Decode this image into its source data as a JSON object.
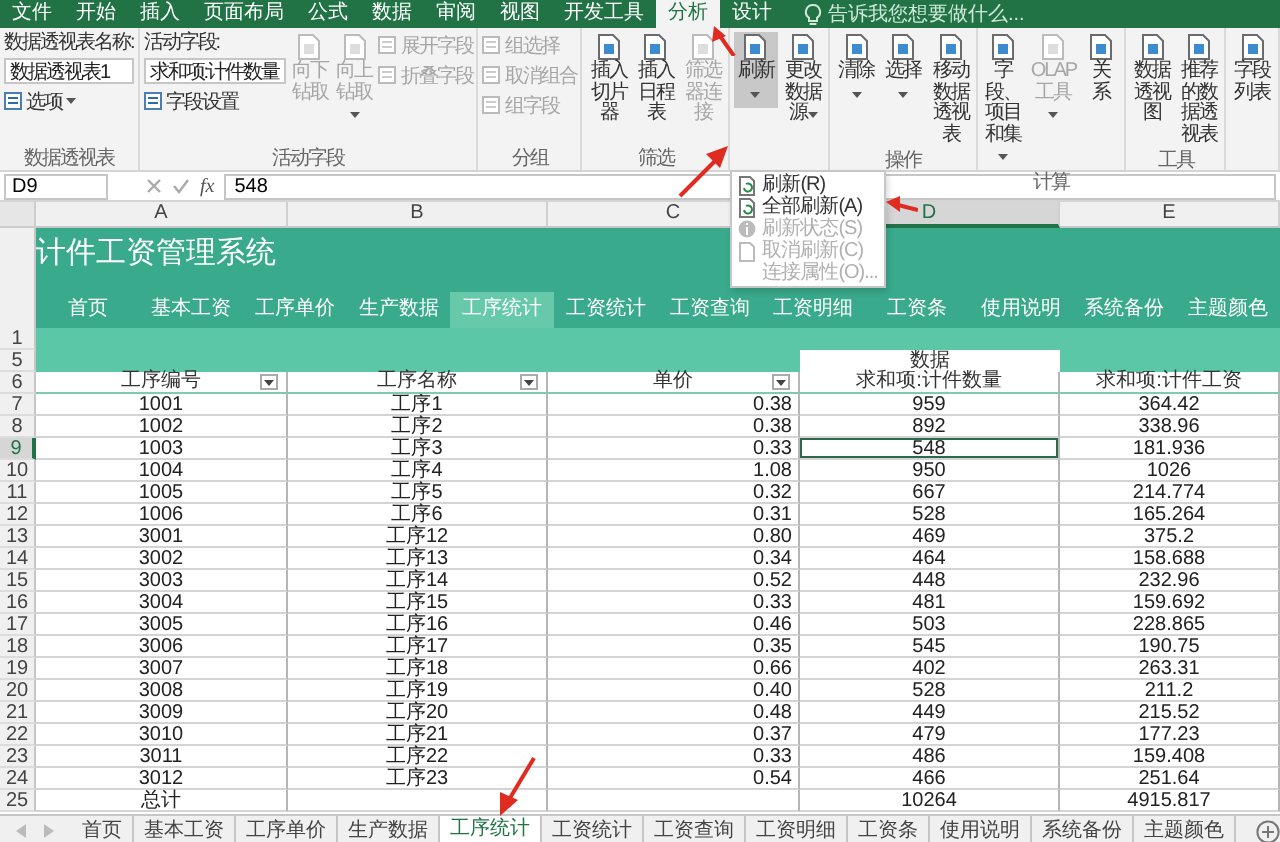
{
  "ribbon_tabs": [
    {
      "label": "文件",
      "selected": false
    },
    {
      "label": "开始",
      "selected": false
    },
    {
      "label": "插入",
      "selected": false
    },
    {
      "label": "页面布局",
      "selected": false
    },
    {
      "label": "公式",
      "selected": false
    },
    {
      "label": "数据",
      "selected": false
    },
    {
      "label": "审阅",
      "selected": false
    },
    {
      "label": "视图",
      "selected": false
    },
    {
      "label": "开发工具",
      "selected": false
    },
    {
      "label": "分析",
      "selected": true,
      "arrow": true
    },
    {
      "label": "设计",
      "selected": false
    }
  ],
  "tell_me": {
    "placeholder": "告诉我您想要做什么..."
  },
  "ribbon_groups": [
    {
      "label": "数据透视表",
      "columns": [
        {
          "kind": "stack",
          "items": [
            {
              "kind": "text",
              "text": "数据透视表名称:"
            },
            {
              "kind": "field",
              "value": "数据透视表1"
            },
            {
              "kind": "small",
              "label": "选项",
              "dropdown": true,
              "disabled": false
            }
          ]
        }
      ]
    },
    {
      "label": "活动字段",
      "columns": [
        {
          "kind": "stack",
          "items": [
            {
              "kind": "text",
              "text": "活动字段:"
            },
            {
              "kind": "field",
              "value": "求和项:计件数量"
            },
            {
              "kind": "small",
              "label": "字段设置",
              "disabled": false
            }
          ]
        },
        {
          "kind": "large",
          "label": "向下钻取",
          "disabled": true
        },
        {
          "kind": "large",
          "label": "向上钻取",
          "dropdown": true,
          "disabled": true
        },
        {
          "kind": "stack",
          "items": [
            {
              "kind": "small",
              "label": "展开字段",
              "disabled": true
            },
            {
              "kind": "small",
              "label": "折叠字段",
              "disabled": true
            }
          ]
        }
      ]
    },
    {
      "label": "分组",
      "columns": [
        {
          "kind": "stack",
          "items": [
            {
              "kind": "small",
              "label": "组选择",
              "disabled": true
            },
            {
              "kind": "small",
              "label": "取消组合",
              "disabled": true
            },
            {
              "kind": "small",
              "label": "组字段",
              "disabled": true
            }
          ]
        }
      ]
    },
    {
      "label": "筛选",
      "columns": [
        {
          "kind": "large",
          "label": "插入切片器",
          "disabled": false
        },
        {
          "kind": "large",
          "label": "插入日程表",
          "disabled": false
        },
        {
          "kind": "large",
          "label": "筛选器连接",
          "disabled": true
        }
      ]
    },
    {
      "columns": [
        {
          "kind": "large",
          "label": "刷新",
          "dropdown": true,
          "disabled": false,
          "pressed": true,
          "arrow": true
        },
        {
          "kind": "large",
          "label": "更改数据源",
          "dropdown": true,
          "disabled": false
        }
      ]
    },
    {
      "label": "操作",
      "columns": [
        {
          "kind": "large",
          "label": "清除",
          "dropdown": true,
          "disabled": false
        },
        {
          "kind": "large",
          "label": "选择",
          "dropdown": true,
          "disabled": false
        },
        {
          "kind": "large",
          "label": "移动数据透视表",
          "disabled": false
        }
      ]
    },
    {
      "label": "计算",
      "columns": [
        {
          "kind": "large",
          "label": "字段、项目和集",
          "dropdown": true,
          "disabled": false
        },
        {
          "kind": "large",
          "label": "OLAP 工具",
          "dropdown": true,
          "disabled": true
        },
        {
          "kind": "large",
          "label": "关系",
          "disabled": false
        }
      ]
    },
    {
      "label": "工具",
      "columns": [
        {
          "kind": "large",
          "label": "数据透视图",
          "disabled": false
        },
        {
          "kind": "large",
          "label": "推荐的数据透视表",
          "disabled": false
        }
      ]
    },
    {
      "columns": [
        {
          "kind": "large",
          "label": "字段列表",
          "disabled": false
        }
      ]
    }
  ],
  "refresh_menu": [
    {
      "label": "刷新(R)",
      "disabled": false
    },
    {
      "label": "全部刷新(A)",
      "disabled": false,
      "arrow": true
    },
    {
      "label": "刷新状态(S)",
      "disabled": true
    },
    {
      "label": "取消刷新(C)",
      "disabled": true
    },
    {
      "label": "连接属性(O)...",
      "disabled": true
    }
  ],
  "formula_bar": {
    "name_box": "D9",
    "fx": "fx",
    "value": "548"
  },
  "columns": [
    {
      "label": "A",
      "selected": false
    },
    {
      "label": "B",
      "selected": false
    },
    {
      "label": "C",
      "selected": false
    },
    {
      "label": "D",
      "selected": true
    },
    {
      "label": "E",
      "selected": false
    }
  ],
  "banner": {
    "title": "计件工资管理系统",
    "nav": [
      {
        "label": "首页",
        "selected": false
      },
      {
        "label": "基本工资",
        "selected": false
      },
      {
        "label": "工序单价",
        "selected": false
      },
      {
        "label": "生产数据",
        "selected": false
      },
      {
        "label": "工序统计",
        "selected": true
      },
      {
        "label": "工资统计",
        "selected": false
      },
      {
        "label": "工资查询",
        "selected": false
      },
      {
        "label": "工资明细",
        "selected": false
      },
      {
        "label": "工资条",
        "selected": false
      },
      {
        "label": "使用说明",
        "selected": false
      },
      {
        "label": "系统备份",
        "selected": false
      },
      {
        "label": "主题颜色",
        "selected": false
      }
    ]
  },
  "band_row": "1",
  "pivot_row": {
    "number": "5",
    "label": "数据"
  },
  "header_row": {
    "number": "6",
    "cells": [
      {
        "text": "工序编号",
        "filter": true
      },
      {
        "text": "工序名称",
        "filter": true
      },
      {
        "text": "单价",
        "filter": true
      },
      {
        "text": "求和项:计件数量",
        "filter": false
      },
      {
        "text": "求和项:计件工资",
        "filter": false
      }
    ]
  },
  "rows": [
    {
      "number": "7",
      "selected": false,
      "cells": [
        "1001",
        "工序1",
        "0.38",
        "959",
        "364.42"
      ]
    },
    {
      "number": "8",
      "selected": false,
      "cells": [
        "1002",
        "工序2",
        "0.38",
        "892",
        "338.96"
      ]
    },
    {
      "number": "9",
      "selected": true,
      "cells": [
        "1003",
        "工序3",
        "0.33",
        "548",
        "181.936"
      ]
    },
    {
      "number": "10",
      "selected": false,
      "cells": [
        "1004",
        "工序4",
        "1.08",
        "950",
        "1026"
      ]
    },
    {
      "number": "11",
      "selected": false,
      "cells": [
        "1005",
        "工序5",
        "0.32",
        "667",
        "214.774"
      ]
    },
    {
      "number": "12",
      "selected": false,
      "cells": [
        "1006",
        "工序6",
        "0.31",
        "528",
        "165.264"
      ]
    },
    {
      "number": "13",
      "selected": false,
      "cells": [
        "3001",
        "工序12",
        "0.80",
        "469",
        "375.2"
      ]
    },
    {
      "number": "14",
      "selected": false,
      "cells": [
        "3002",
        "工序13",
        "0.34",
        "464",
        "158.688"
      ]
    },
    {
      "number": "15",
      "selected": false,
      "cells": [
        "3003",
        "工序14",
        "0.52",
        "448",
        "232.96"
      ]
    },
    {
      "number": "16",
      "selected": false,
      "cells": [
        "3004",
        "工序15",
        "0.33",
        "481",
        "159.692"
      ]
    },
    {
      "number": "17",
      "selected": false,
      "cells": [
        "3005",
        "工序16",
        "0.46",
        "503",
        "228.865"
      ]
    },
    {
      "number": "18",
      "selected": false,
      "cells": [
        "3006",
        "工序17",
        "0.35",
        "545",
        "190.75"
      ]
    },
    {
      "number": "19",
      "selected": false,
      "cells": [
        "3007",
        "工序18",
        "0.66",
        "402",
        "263.31"
      ]
    },
    {
      "number": "20",
      "selected": false,
      "cells": [
        "3008",
        "工序19",
        "0.40",
        "528",
        "211.2"
      ]
    },
    {
      "number": "21",
      "selected": false,
      "cells": [
        "3009",
        "工序20",
        "0.48",
        "449",
        "215.52"
      ]
    },
    {
      "number": "22",
      "selected": false,
      "cells": [
        "3010",
        "工序21",
        "0.37",
        "479",
        "177.23"
      ]
    },
    {
      "number": "23",
      "selected": false,
      "cells": [
        "3011",
        "工序22",
        "0.33",
        "486",
        "159.408"
      ]
    },
    {
      "number": "24",
      "selected": false,
      "cells": [
        "3012",
        "工序23",
        "0.54",
        "466",
        "251.64"
      ]
    }
  ],
  "total_row": {
    "number": "25",
    "label": "总计",
    "quantity": "10264",
    "wage": "4915.817"
  },
  "sheet_tabs": [
    {
      "label": "首页",
      "selected": false
    },
    {
      "label": "基本工资",
      "selected": false
    },
    {
      "label": "工序单价",
      "selected": false
    },
    {
      "label": "生产数据",
      "selected": false
    },
    {
      "label": "工序统计",
      "selected": true,
      "arrow": true
    },
    {
      "label": "工资统计",
      "selected": false
    },
    {
      "label": "工资查询",
      "selected": false
    },
    {
      "label": "工资明细",
      "selected": false
    },
    {
      "label": "工资条",
      "selected": false
    },
    {
      "label": "使用说明",
      "selected": false
    },
    {
      "label": "系统备份",
      "selected": false
    },
    {
      "label": "主题颜色",
      "selected": false
    }
  ]
}
